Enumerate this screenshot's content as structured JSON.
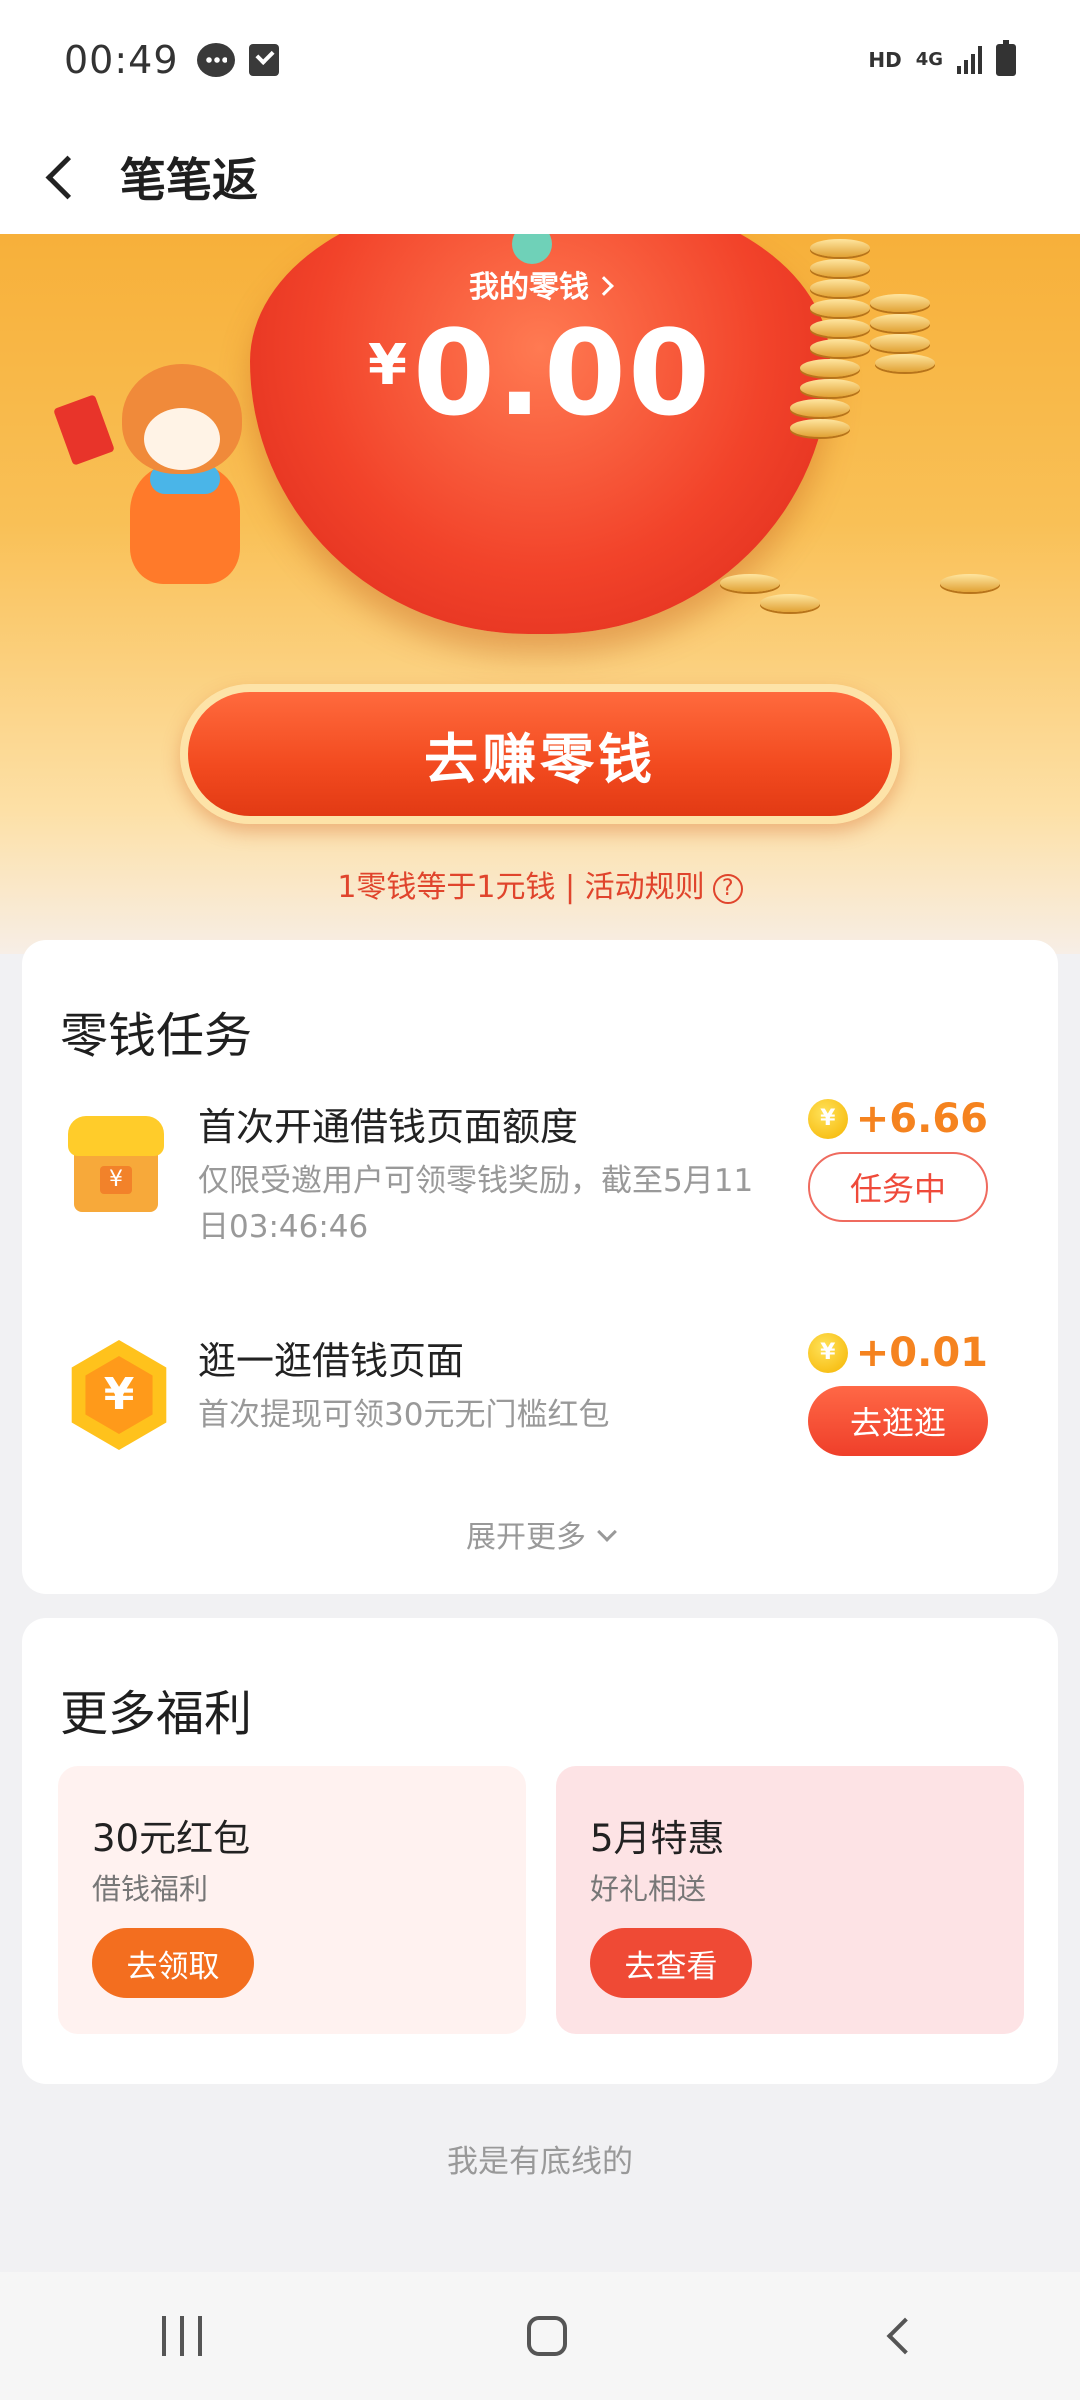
{
  "status_bar": {
    "time": "00:49",
    "hd": "HD",
    "network": "4G",
    "icons": [
      "message-icon",
      "check-square-icon",
      "signal-icon",
      "battery-icon"
    ]
  },
  "header": {
    "title": "笔笔返"
  },
  "hero": {
    "wallet_label": "我的零钱",
    "currency": "¥",
    "amount": "0.00",
    "earn_button": "去赚零钱",
    "rule_text": "1零钱等于1元钱 | 活动规则",
    "help_icon": "?"
  },
  "tasks": {
    "title": "零钱任务",
    "items": [
      {
        "icon": "shop-icon",
        "title": "首次开通借钱页面额度",
        "desc": "仅限受邀用户可领零钱奖励，截至5月11日03:46:46",
        "reward": "+6.66",
        "action": "任务中"
      },
      {
        "icon": "yuan-hexagon-icon",
        "title": "逛一逛借钱页面",
        "desc": "首次提现可领30元无门槛红包",
        "reward": "+0.01",
        "action": "去逛逛"
      }
    ],
    "expand": "展开更多"
  },
  "benefits": {
    "title": "更多福利",
    "tiles": [
      {
        "title": "30元红包",
        "subtitle": "借钱福利",
        "button": "去领取"
      },
      {
        "title": "5月特惠",
        "subtitle": "好礼相送",
        "button": "去查看"
      }
    ]
  },
  "footer": "我是有底线的",
  "colors": {
    "accent": "#f24a1f",
    "reward": "#f5831f",
    "hero_top": "#f7b03a"
  }
}
